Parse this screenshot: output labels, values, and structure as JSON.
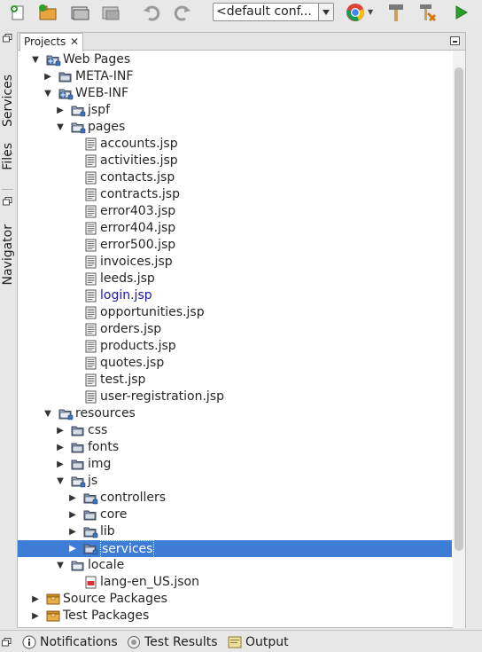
{
  "toolbar": {
    "config_value": "<default conf...",
    "icons": [
      "new-file-icon",
      "new-project-icon",
      "open-project-icon",
      "close-project-icon",
      "undo-icon",
      "redo-icon",
      "browser-icon",
      "build-icon",
      "clean-build-icon",
      "run-icon"
    ]
  },
  "side_tabs": {
    "services": "Services",
    "files": "Files",
    "navigator": "Navigator"
  },
  "panel": {
    "tab_label": "Projects",
    "tab_close": "✕"
  },
  "tree": [
    {
      "label": "Web Pages",
      "icon": "webpages"
    },
    {
      "label": "META-INF",
      "icon": "folder"
    },
    {
      "label": "WEB-INF",
      "icon": "webfolder"
    },
    {
      "label": "jspf",
      "icon": "folder-open-pkg"
    },
    {
      "label": "pages",
      "icon": "folder-open-pkg"
    },
    {
      "label": "accounts.jsp",
      "icon": "jsp"
    },
    {
      "label": "activities.jsp",
      "icon": "jsp"
    },
    {
      "label": "contacts.jsp",
      "icon": "jsp"
    },
    {
      "label": "contracts.jsp",
      "icon": "jsp"
    },
    {
      "label": "error403.jsp",
      "icon": "jsp"
    },
    {
      "label": "error404.jsp",
      "icon": "jsp"
    },
    {
      "label": "error500.jsp",
      "icon": "jsp"
    },
    {
      "label": "invoices.jsp",
      "icon": "jsp"
    },
    {
      "label": "leeds.jsp",
      "icon": "jsp"
    },
    {
      "label": "login.jsp",
      "icon": "jsp"
    },
    {
      "label": "opportunities.jsp",
      "icon": "jsp"
    },
    {
      "label": "orders.jsp",
      "icon": "jsp"
    },
    {
      "label": "products.jsp",
      "icon": "jsp"
    },
    {
      "label": "quotes.jsp",
      "icon": "jsp"
    },
    {
      "label": "test.jsp",
      "icon": "jsp"
    },
    {
      "label": "user-registration.jsp",
      "icon": "jsp"
    },
    {
      "label": "resources",
      "icon": "folder-open-pkg"
    },
    {
      "label": "css",
      "icon": "folder"
    },
    {
      "label": "fonts",
      "icon": "folder"
    },
    {
      "label": "img",
      "icon": "folder"
    },
    {
      "label": "js",
      "icon": "folder-open-pkg"
    },
    {
      "label": "controllers",
      "icon": "folder-pkg"
    },
    {
      "label": "core",
      "icon": "folder"
    },
    {
      "label": "lib",
      "icon": "folder-pkg"
    },
    {
      "label": "services",
      "icon": "folder-pkg"
    },
    {
      "label": "locale",
      "icon": "folder-open"
    },
    {
      "label": "lang-en_US.json",
      "icon": "json"
    },
    {
      "label": "Source Packages",
      "icon": "package"
    },
    {
      "label": "Test Packages",
      "icon": "package"
    }
  ],
  "bottom": {
    "notifications": "Notifications",
    "test_results": "Test Results",
    "output": "Output"
  },
  "colors": {
    "selection": "#3d7dd6",
    "link_text": "#1a1aa6",
    "run": "#2aa02a"
  }
}
